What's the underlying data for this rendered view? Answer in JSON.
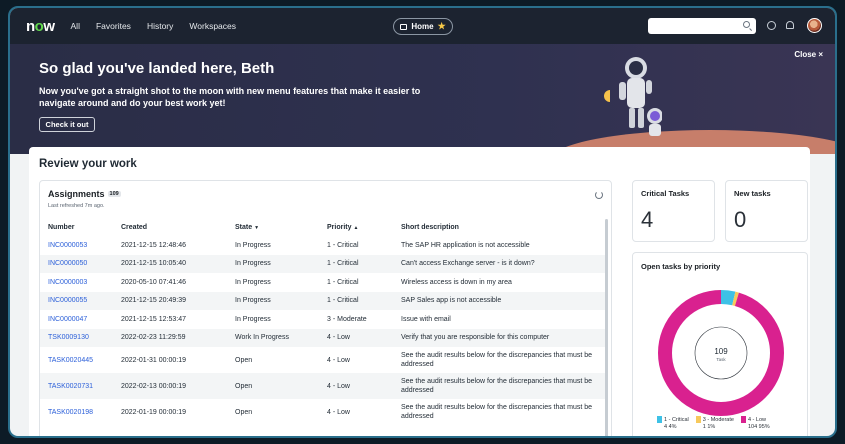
{
  "nav": {
    "logo_prefix": "n",
    "logo_o": "o",
    "logo_suffix": "w",
    "links": [
      "All",
      "Favorites",
      "History",
      "Workspaces"
    ],
    "home_label": "Home",
    "search_placeholder": ""
  },
  "hero": {
    "title": "So glad you've landed here, Beth",
    "subtitle": "Now you've got a straight shot to the moon with new menu features that make it easier to navigate around and do your best work yet!",
    "button": "Check it out",
    "close": "Close ×"
  },
  "review": {
    "title": "Review your work",
    "assignments": {
      "title": "Assignments",
      "count": "109",
      "refreshed": "Last refreshed 7m ago.",
      "columns": [
        "Number",
        "Created",
        "State",
        "Priority",
        "Short description"
      ],
      "rows": [
        {
          "number": "INC0000053",
          "created": "2021-12-15 12:48:46",
          "state": "In Progress",
          "priority": "1 - Critical",
          "desc": "The SAP HR application is not accessible"
        },
        {
          "number": "INC0000050",
          "created": "2021-12-15 10:05:40",
          "state": "In Progress",
          "priority": "1 - Critical",
          "desc": "Can't access Exchange server - is it down?"
        },
        {
          "number": "INC0000003",
          "created": "2020-05-10 07:41:46",
          "state": "In Progress",
          "priority": "1 - Critical",
          "desc": "Wireless access is down in my area"
        },
        {
          "number": "INC0000055",
          "created": "2021-12-15 20:49:39",
          "state": "In Progress",
          "priority": "1 - Critical",
          "desc": "SAP Sales app is not accessible"
        },
        {
          "number": "INC0000047",
          "created": "2021-12-15 12:53:47",
          "state": "In Progress",
          "priority": "3 - Moderate",
          "desc": "Issue with email"
        },
        {
          "number": "TSK0009130",
          "created": "2022-02-23 11:29:59",
          "state": "Work In Progress",
          "priority": "4 - Low",
          "desc": "Verify that you are responsible for this computer"
        },
        {
          "number": "TASK0020445",
          "created": "2022-01-31 00:00:19",
          "state": "Open",
          "priority": "4 - Low",
          "desc": "See the audit results below for the discrepancies that must be addressed"
        },
        {
          "number": "TASK0020731",
          "created": "2022-02-13 00:00:19",
          "state": "Open",
          "priority": "4 - Low",
          "desc": "See the audit results below for the discrepancies that must be addressed"
        },
        {
          "number": "TASK0020198",
          "created": "2022-01-19 00:00:19",
          "state": "Open",
          "priority": "4 - Low",
          "desc": "See the audit results below for the discrepancies that must be addressed"
        }
      ]
    },
    "critical": {
      "label": "Critical Tasks",
      "value": "4"
    },
    "newtasks": {
      "label": "New tasks",
      "value": "0"
    },
    "donut": {
      "label": "Open tasks by priority",
      "center_value": "109",
      "center_label": "Task",
      "segments": [
        {
          "name": "1 - Critical",
          "count": "4",
          "pct": "4%",
          "value": 4,
          "color": "#3ec1e6"
        },
        {
          "name": "3 - Moderate",
          "count": "1",
          "pct": "1%",
          "value": 1,
          "color": "#f7c95c"
        },
        {
          "name": "4 - Low",
          "count": "104",
          "pct": "95%",
          "value": 104,
          "color": "#d9218f"
        }
      ]
    }
  }
}
